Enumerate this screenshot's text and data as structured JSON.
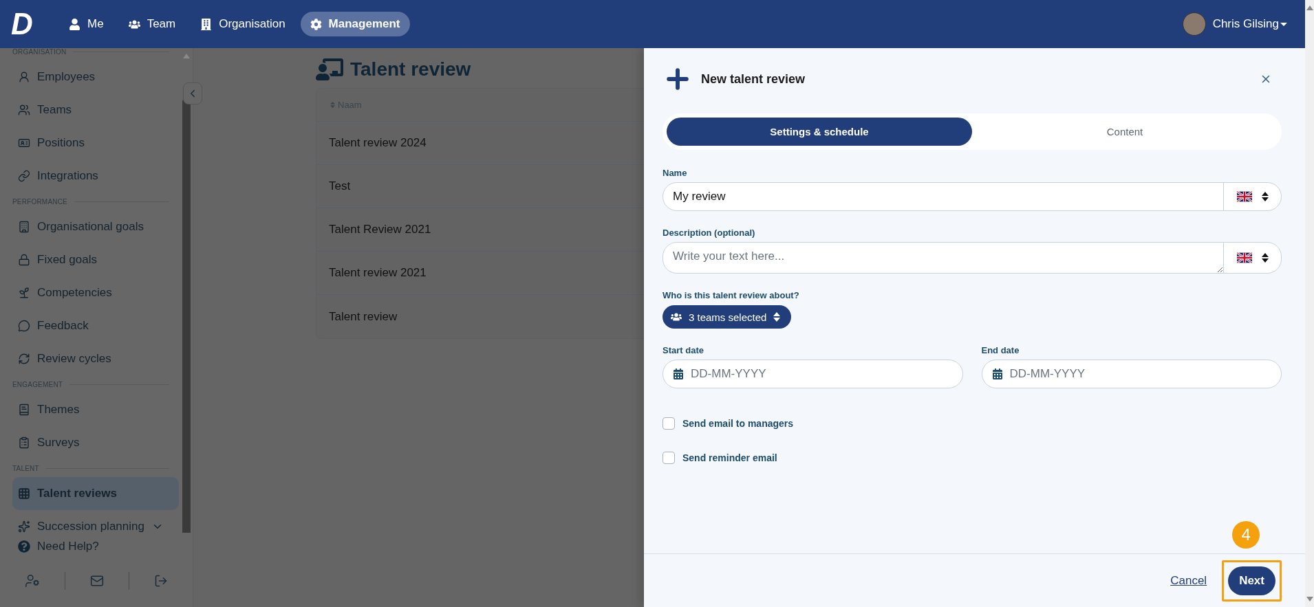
{
  "app": {
    "logo": "D"
  },
  "nav": [
    {
      "label": "Me",
      "selected": false
    },
    {
      "label": "Team",
      "selected": false
    },
    {
      "label": "Organisation",
      "selected": false
    },
    {
      "label": "Management",
      "selected": true
    }
  ],
  "user": {
    "name": "Chris Gilsing"
  },
  "sidebar": {
    "sections": [
      {
        "title": "ORGANISATION",
        "items": [
          {
            "label": "Employees",
            "selected": false
          },
          {
            "label": "Teams",
            "selected": false
          },
          {
            "label": "Positions",
            "selected": false
          },
          {
            "label": "Integrations",
            "selected": false
          }
        ]
      },
      {
        "title": "PERFORMANCE",
        "items": [
          {
            "label": "Organisational goals",
            "selected": false
          },
          {
            "label": "Fixed goals",
            "selected": false
          },
          {
            "label": "Competencies",
            "selected": false
          },
          {
            "label": "Feedback",
            "selected": false
          },
          {
            "label": "Review cycles",
            "selected": false
          }
        ]
      },
      {
        "title": "ENGAGEMENT",
        "items": [
          {
            "label": "Themes",
            "selected": false
          },
          {
            "label": "Surveys",
            "selected": false
          }
        ]
      },
      {
        "title": "TALENT",
        "items": [
          {
            "label": "Talent reviews",
            "selected": true
          },
          {
            "label": "Succession planning",
            "selected": false,
            "expanded": false
          }
        ]
      }
    ],
    "help": "Need Help?"
  },
  "page": {
    "title": "Talent review",
    "table": {
      "columns": [
        "Naam"
      ],
      "rows": [
        {
          "name": "Talent review 2024"
        },
        {
          "name": "Test"
        },
        {
          "name": "Talent Review 2021"
        },
        {
          "name": "Talent review 2021"
        },
        {
          "name": "Talent review"
        }
      ]
    }
  },
  "panel": {
    "title": "New talent review",
    "tabs": [
      {
        "label": "Settings & schedule",
        "selected": true
      },
      {
        "label": "Content",
        "selected": false
      }
    ],
    "name": {
      "label": "Name",
      "value": "My review"
    },
    "description": {
      "label": "Description (optional)",
      "placeholder": "Write your text here..."
    },
    "audience": {
      "label": "Who is this talent review about?",
      "value": "3 teams selected"
    },
    "start_date": {
      "label": "Start date",
      "placeholder": "DD-MM-YYYY"
    },
    "end_date": {
      "label": "End date",
      "placeholder": "DD-MM-YYYY"
    },
    "checkboxes": [
      {
        "label": "Send email to managers",
        "checked": false
      },
      {
        "label": "Send reminder email",
        "checked": false
      }
    ],
    "footer": {
      "cancel": "Cancel",
      "next": "Next",
      "step_marker": "4"
    }
  }
}
